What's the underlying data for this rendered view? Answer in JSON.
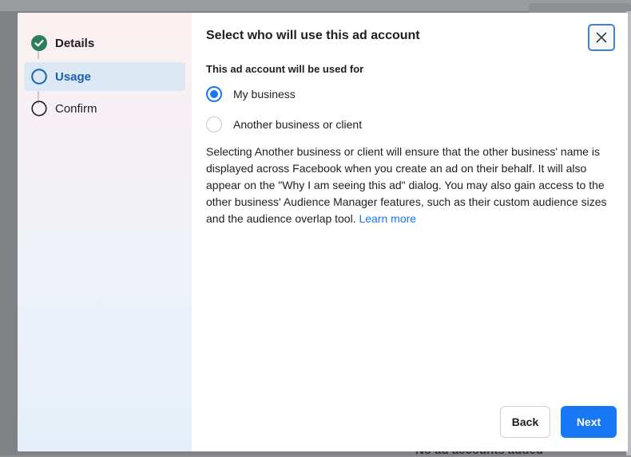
{
  "background": {
    "bottom_text": "No ad accounts added"
  },
  "sidebar": {
    "steps": [
      {
        "label": "Details",
        "state": "completed",
        "icon": "check-circle-icon"
      },
      {
        "label": "Usage",
        "state": "current",
        "icon": "empty-circle-icon"
      },
      {
        "label": "Confirm",
        "state": "pending",
        "icon": "empty-circle-icon"
      }
    ]
  },
  "dialog": {
    "title": "Select who will use this ad account",
    "close_icon": "close-icon",
    "section_label": "This ad account will be used for",
    "options": [
      {
        "label": "My business",
        "checked": true
      },
      {
        "label": "Another business or client",
        "checked": false
      }
    ],
    "description": "Selecting Another business or client will ensure that the other business' name is displayed across Facebook when you create an ad on their behalf. It will also appear on the \"Why I am seeing this ad\" dialog. You may also gain access to the other business' Audience Manager features, such as their custom audience sizes and the audience overlap tool.",
    "learn_more": "Learn more",
    "back_label": "Back",
    "next_label": "Next"
  },
  "colors": {
    "accent": "#1877f2",
    "completed": "#2e7d5b",
    "active_step_bg": "#dde8f5"
  }
}
